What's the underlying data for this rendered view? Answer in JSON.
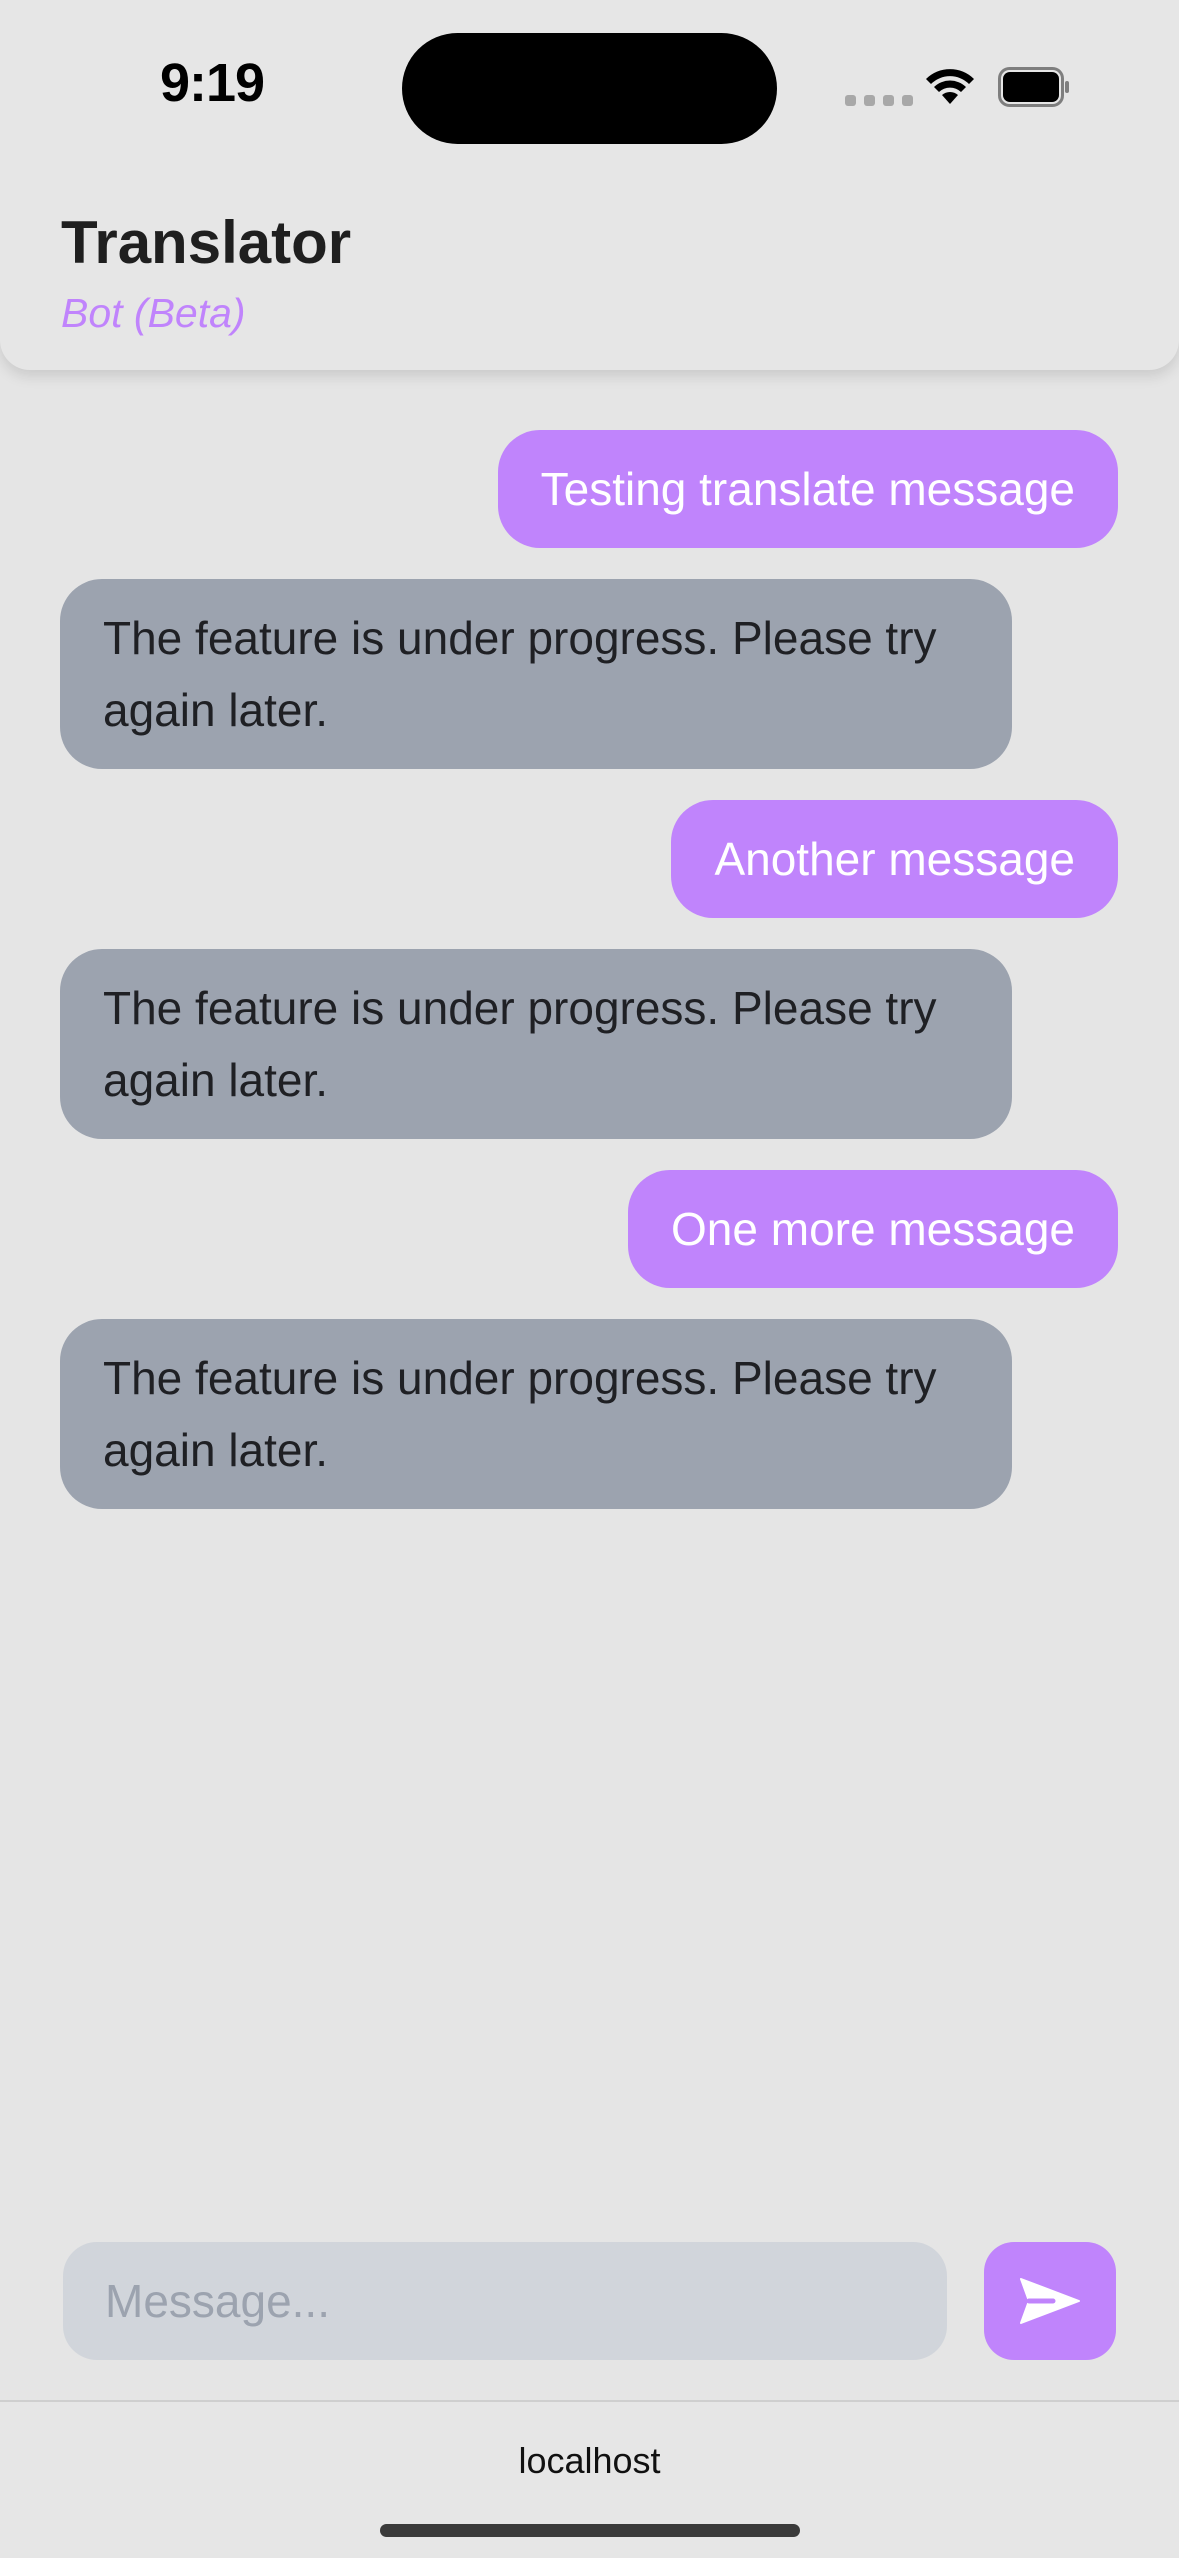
{
  "status_bar": {
    "time": "9:19"
  },
  "header": {
    "title": "Translator",
    "subtitle": "Bot (Beta)"
  },
  "messages": [
    {
      "sender": "user",
      "text": "Testing translate message"
    },
    {
      "sender": "bot",
      "text": "The feature is under progress. Please try again later."
    },
    {
      "sender": "user",
      "text": "Another message"
    },
    {
      "sender": "bot",
      "text": "The feature is under progress. Please try again later."
    },
    {
      "sender": "user",
      "text": "One more message"
    },
    {
      "sender": "bot",
      "text": "The feature is under progress. Please try again later."
    }
  ],
  "composer": {
    "placeholder": "Message...",
    "value": "",
    "send_icon": "send-icon"
  },
  "browser": {
    "url": "localhost"
  },
  "colors": {
    "accent": "#c084fc",
    "bot_bubble": "#9ca3af",
    "input_bg": "#d1d5db",
    "background": "#e5e5e5"
  }
}
